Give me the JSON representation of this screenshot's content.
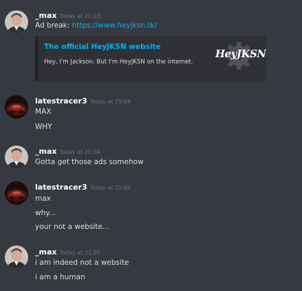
{
  "messages": [
    {
      "author": "_max",
      "timestamp": "Today at 21:03",
      "prefix": "Ad break: ",
      "link": "https://www.heyjksn.tk/",
      "embed": {
        "title": "The official HeyJKSN website",
        "description": "Hey, I'm Jackson. But I'm HeyJKSN on the internet.",
        "thumbnail_text": "HeyJKSN"
      }
    },
    {
      "author": "latestracer3",
      "timestamp": "Today at 21:04",
      "lines": [
        "MAX",
        "WHY"
      ]
    },
    {
      "author": "_max",
      "timestamp": "Today at 21:04",
      "lines": [
        "Gotta get those ads somehow"
      ]
    },
    {
      "author": "latestracer3",
      "timestamp": "Today at 21:05",
      "lines": [
        "max",
        "why...",
        "your not a website..."
      ]
    },
    {
      "author": "_max",
      "timestamp": "Today at 21:05",
      "lines": [
        "i am indeed not a website",
        "i am a human"
      ]
    }
  ],
  "colors": {
    "background": "#36393f",
    "username": "#ffffff",
    "timestamp": "#72767d",
    "text": "#dcddde",
    "link": "#00b0f4",
    "embed_background": "#2f3136"
  }
}
